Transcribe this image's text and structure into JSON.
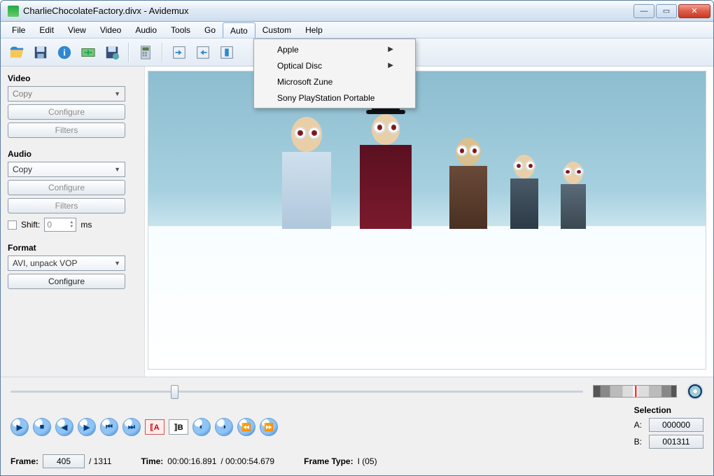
{
  "title": "CharlieChocolateFactory.divx - Avidemux",
  "menu": [
    "File",
    "Edit",
    "View",
    "Video",
    "Audio",
    "Tools",
    "Go",
    "Auto",
    "Custom",
    "Help"
  ],
  "menu_active_index": 7,
  "dropdown": {
    "items": [
      {
        "label": "Apple",
        "submenu": true
      },
      {
        "label": "Optical Disc",
        "submenu": true
      },
      {
        "label": "Microsoft Zune",
        "submenu": false
      },
      {
        "label": "Sony PlayStation Portable",
        "submenu": false
      }
    ]
  },
  "sidebar": {
    "video": {
      "heading": "Video",
      "codec": "Copy",
      "configure": "Configure",
      "filters": "Filters"
    },
    "audio": {
      "heading": "Audio",
      "codec": "Copy",
      "configure": "Configure",
      "filters": "Filters",
      "shift_label": "Shift:",
      "shift_value": "0",
      "shift_unit": "ms"
    },
    "format": {
      "heading": "Format",
      "container": "AVI, unpack VOP",
      "configure": "Configure"
    }
  },
  "selection": {
    "heading": "Selection",
    "a_label": "A:",
    "a_value": "000000",
    "b_label": "B:",
    "b_value": "001311"
  },
  "status": {
    "frame_label": "Frame:",
    "frame_cur": "405",
    "frame_total": "/ 1311",
    "time_label": "Time:",
    "time_cur": "00:00:16.891",
    "time_total": "/ 00:00:54.679",
    "frametype_label": "Frame Type:",
    "frametype_value": "I (05)"
  },
  "toolbar_icons": [
    "open-icon",
    "save-icon",
    "info-icon",
    "append-icon",
    "savejpg-icon",
    "calc-icon",
    "marker-in-icon",
    "marker-out-icon",
    "cut-icon"
  ],
  "playback_icons": [
    "play-icon",
    "stop-icon",
    "prev-frame-icon",
    "next-frame-icon",
    "prev-key-icon",
    "next-key-icon",
    "mark-a",
    "mark-b",
    "prev-black-icon",
    "next-black-icon",
    "first-icon",
    "last-icon"
  ]
}
